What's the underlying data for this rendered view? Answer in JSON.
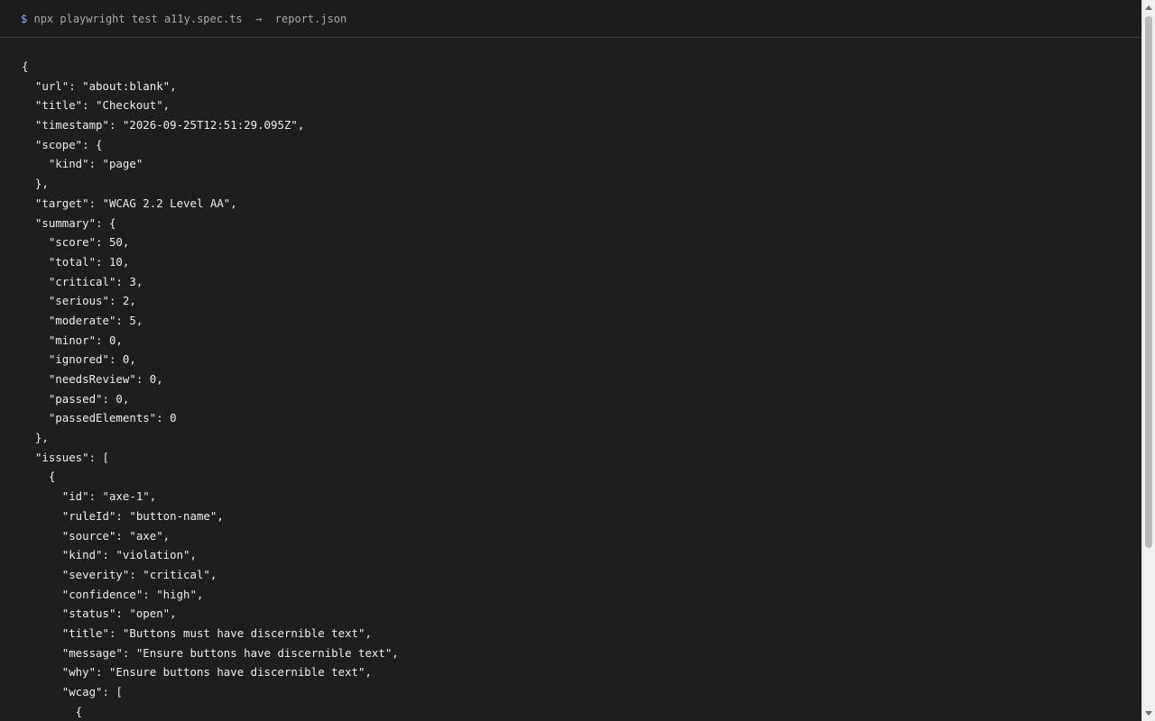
{
  "terminal": {
    "prompt_symbol": "$",
    "command": "npx playwright test a11y.spec.ts",
    "arrow": "→",
    "output_file": "report.json"
  },
  "json_lines": [
    "{",
    "  \"url\": \"about:blank\",",
    "  \"title\": \"Checkout\",",
    "  \"timestamp\": \"2026-09-25T12:51:29.095Z\",",
    "  \"scope\": {",
    "    \"kind\": \"page\"",
    "  },",
    "  \"target\": \"WCAG 2.2 Level AA\",",
    "  \"summary\": {",
    "    \"score\": 50,",
    "    \"total\": 10,",
    "    \"critical\": 3,",
    "    \"serious\": 2,",
    "    \"moderate\": 5,",
    "    \"minor\": 0,",
    "    \"ignored\": 0,",
    "    \"needsReview\": 0,",
    "    \"passed\": 0,",
    "    \"passedElements\": 0",
    "  },",
    "  \"issues\": [",
    "    {",
    "      \"id\": \"axe-1\",",
    "      \"ruleId\": \"button-name\",",
    "      \"source\": \"axe\",",
    "      \"kind\": \"violation\",",
    "      \"severity\": \"critical\",",
    "      \"confidence\": \"high\",",
    "      \"status\": \"open\",",
    "      \"title\": \"Buttons must have discernible text\",",
    "      \"message\": \"Ensure buttons have discernible text\",",
    "      \"why\": \"Ensure buttons have discernible text\",",
    "      \"wcag\": [",
    "        {"
  ]
}
